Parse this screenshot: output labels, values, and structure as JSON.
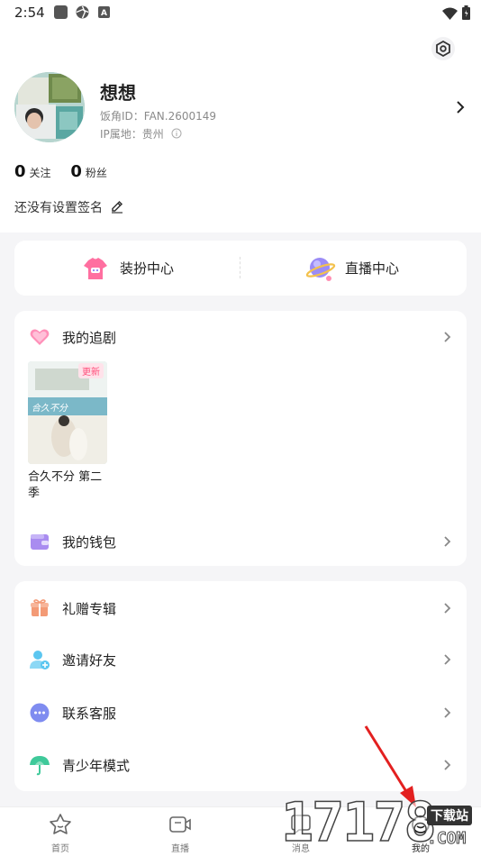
{
  "status_bar": {
    "time": "2:54"
  },
  "profile": {
    "name": "想想",
    "id_label": "饭角ID：",
    "id_value": "FAN.2600149",
    "ip_label": "IP属地：",
    "ip_value": "贵州"
  },
  "stats": [
    {
      "count": "0",
      "label": "关注"
    },
    {
      "count": "0",
      "label": "粉丝"
    }
  ],
  "signature": "还没有设置签名",
  "quick_links": [
    {
      "label": "装扮中心",
      "icon": "shirt-icon"
    },
    {
      "label": "直播中心",
      "icon": "planet-icon"
    }
  ],
  "my_drama": {
    "label": "我的追剧",
    "icon": "heart-icon",
    "items": [
      {
        "title": "合久不分 第二季",
        "badge": "更新",
        "poster_text": "合久不分"
      }
    ]
  },
  "wallet": {
    "label": "我的钱包",
    "icon": "wallet-icon"
  },
  "menu": [
    {
      "label": "礼赠专辑",
      "icon": "gift-icon",
      "color": "#f39a76"
    },
    {
      "label": "邀请好友",
      "icon": "invite-user-icon",
      "color": "#5bc6f0"
    },
    {
      "label": "联系客服",
      "icon": "chat-icon",
      "color": "#7f8cf0"
    },
    {
      "label": "青少年模式",
      "icon": "umbrella-icon",
      "color": "#3fc99a"
    }
  ],
  "tabbar": [
    {
      "label": "首页",
      "icon": "star-home-icon"
    },
    {
      "label": "直播",
      "icon": "video-icon"
    },
    {
      "label": "消息",
      "icon": "message-icon"
    },
    {
      "label": "我的",
      "icon": "profile-icon"
    }
  ],
  "watermark": {
    "number": "17178",
    "site": "下载站",
    "domain": ".COM"
  },
  "colors": {
    "accent_pink": "#ff4e7a",
    "arrow_red": "#e32020"
  }
}
